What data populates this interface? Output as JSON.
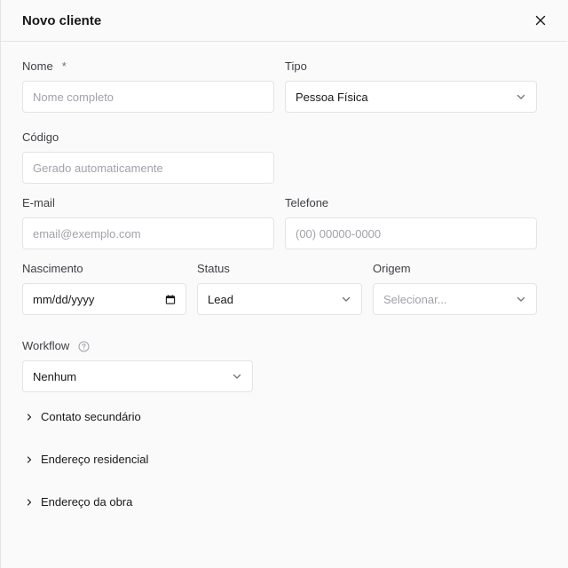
{
  "dialog": {
    "title": "Novo cliente",
    "close_icon": "close-icon"
  },
  "form": {
    "nome": {
      "label": "Nome",
      "required_mark": "*",
      "placeholder": "Nome completo"
    },
    "tipo": {
      "label": "Tipo",
      "value": "Pessoa Física"
    },
    "codigo": {
      "label": "Código",
      "placeholder": "Gerado automaticamente"
    },
    "email": {
      "label": "E-mail",
      "placeholder": "email@exemplo.com"
    },
    "telefone": {
      "label": "Telefone",
      "placeholder": "(00) 00000-0000"
    },
    "nascimento": {
      "label": "Nascimento",
      "value": "mm/dd/yyyy"
    },
    "status": {
      "label": "Status",
      "value": "Lead"
    },
    "origem": {
      "label": "Origem",
      "placeholder": "Selecionar..."
    },
    "workflow": {
      "label": "Workflow",
      "value": "Nenhum"
    }
  },
  "sections": [
    {
      "label": "Contato secundário"
    },
    {
      "label": "Endereço residencial"
    },
    {
      "label": "Endereço da obra"
    }
  ],
  "colors": {
    "border": "#e4e4e7",
    "placeholder": "#a1a1aa",
    "text": "#18181b"
  }
}
